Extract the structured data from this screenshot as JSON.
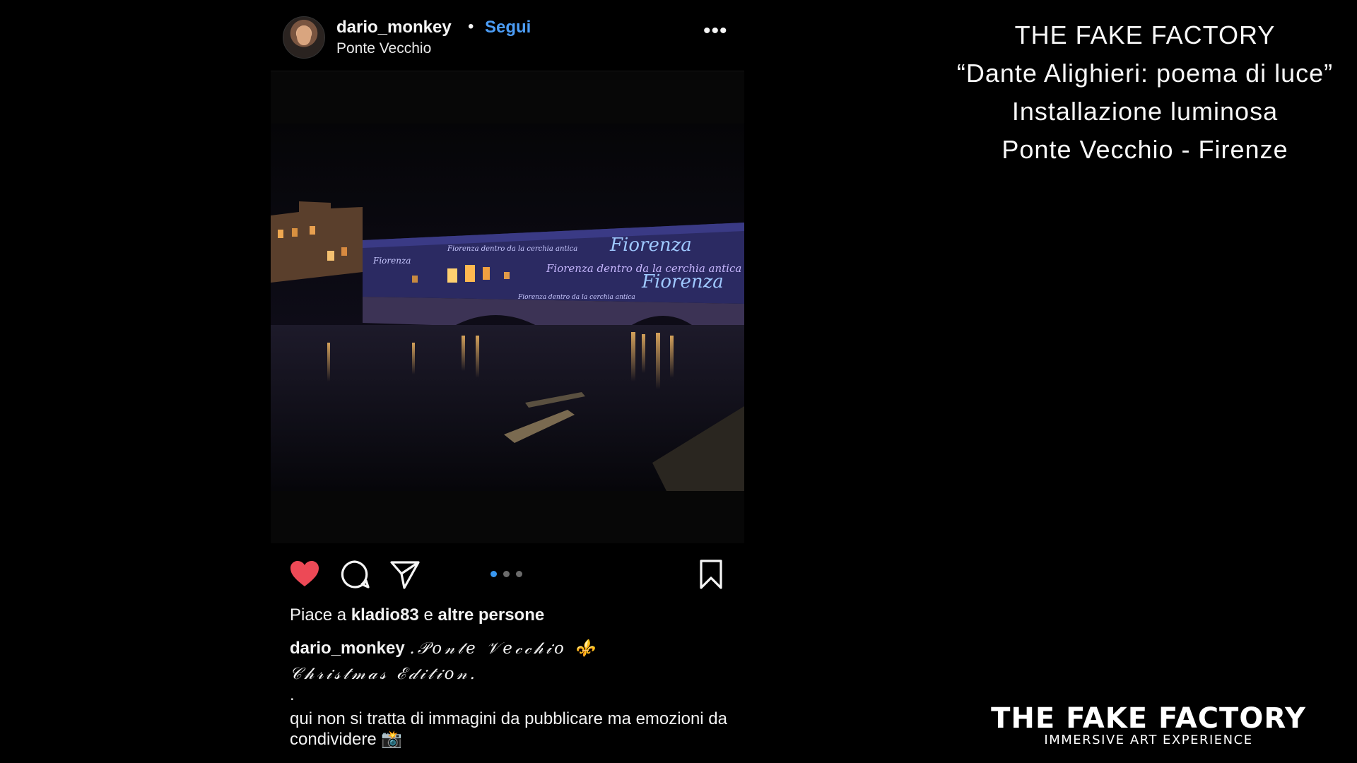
{
  "post": {
    "username": "dario_monkey",
    "separator": "•",
    "follow_label": "Segui",
    "location": "Ponte Vecchio",
    "more_label": "•••",
    "photo_text": {
      "line1": "Fiorenza",
      "line2": "Fiorenza",
      "line3": "Fiorenza dentro da la cerchia antica",
      "line4": "Fiorenza dentro da la cerchia antica",
      "line5": "Fiorenza dentro da la cerchia antica",
      "line6": "Fiorenza"
    },
    "icons": {
      "like": "heart-filled-icon",
      "comment": "comment-bubble-icon",
      "share": "paper-plane-icon",
      "save": "bookmark-icon"
    },
    "like_color": "#ed4956",
    "carousel": {
      "count": 3,
      "active": 0,
      "active_color": "#3897f0"
    },
    "likes_prefix": "Piace a",
    "likes_user": "kladio83",
    "likes_mid": "e",
    "likes_suffix": "altre persone",
    "caption_user": "dario_monkey",
    "caption_title": ".𝒫𝑜𝓃𝓉𝑒 𝒱𝑒𝒸𝒸𝒽𝒾𝑜 ⚜️",
    "caption_title2": "𝒞𝒽𝓇𝒾𝓈𝓉𝓂𝒶𝓈 ℰ𝒹𝒾𝓉𝒾𝑜𝓃.",
    "caption_dot": ".",
    "caption_body": "qui non si tratta di immagini da pubblicare ma emozioni da condividere 📸"
  },
  "info": {
    "line1": "THE FAKE FACTORY",
    "line2": "“Dante Alighieri: poema di luce”",
    "line3": "Installazione luminosa",
    "line4": "Ponte Vecchio - Firenze"
  },
  "brand": {
    "name": "THE FAKE FACTORY",
    "tagline": "IMMERSIVE ART EXPERIENCE"
  }
}
